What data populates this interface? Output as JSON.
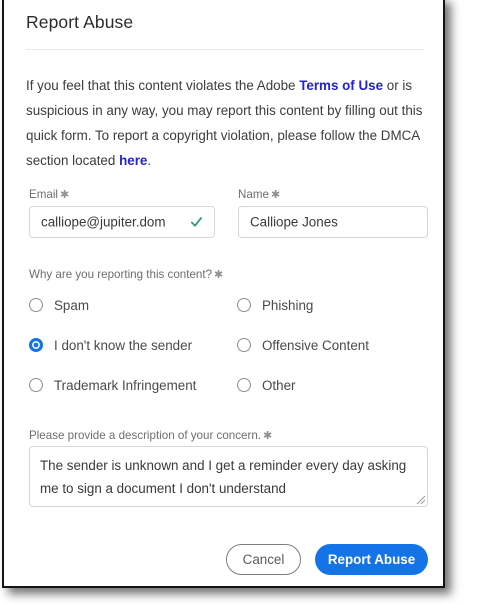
{
  "dialog": {
    "title": "Report Abuse",
    "intro": {
      "part1": "If you feel that this content violates the Adobe ",
      "link1": "Terms of Use",
      "part2": " or is suspicious in any way, you may report this content by filling out this quick form. To report a copyright violation, please follow the DMCA section located ",
      "link2": "here",
      "part3": "."
    }
  },
  "form": {
    "required_marker": "✱",
    "email": {
      "label": "Email",
      "value": "calliope@jupiter.dom",
      "valid_icon": "check-icon"
    },
    "name": {
      "label": "Name",
      "value": "Calliope Jones"
    },
    "reason": {
      "question": "Why are you reporting this content?",
      "options": [
        {
          "label": "Spam",
          "selected": false
        },
        {
          "label": "Phishing",
          "selected": false
        },
        {
          "label": "I don't know the sender",
          "selected": true
        },
        {
          "label": "Offensive Content",
          "selected": false
        },
        {
          "label": "Trademark Infringement",
          "selected": false
        },
        {
          "label": "Other",
          "selected": false
        }
      ]
    },
    "description": {
      "label": "Please provide a description of your concern.",
      "value": "The sender is unknown and I get a reminder every day asking me to sign a document I don't understand"
    }
  },
  "footer": {
    "cancel_label": "Cancel",
    "submit_label": "Report Abuse"
  },
  "colors": {
    "accent_blue": "#1473E6",
    "link_blue": "#2323D0",
    "valid_green": "#2D9D78",
    "text_dark": "#3C3C3C",
    "label_gray": "#6E6E6E",
    "border_gray": "#D6D6D6"
  }
}
